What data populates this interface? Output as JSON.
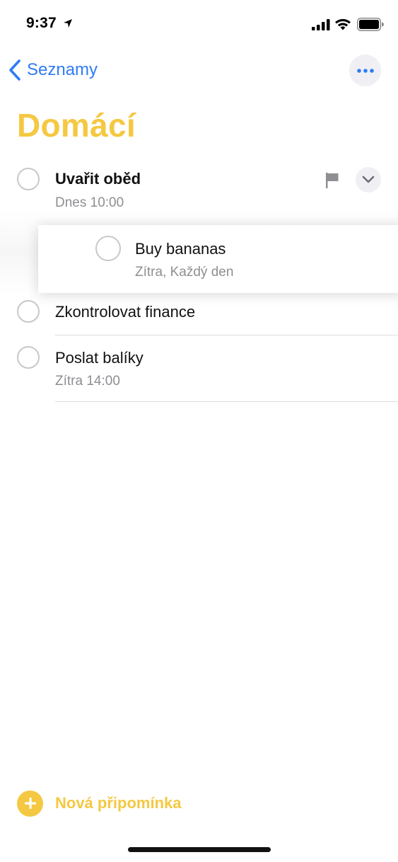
{
  "status_bar": {
    "time": "9:37"
  },
  "nav": {
    "back_label": "Seznamy"
  },
  "page": {
    "title": "Domácí"
  },
  "reminders": [
    {
      "title": "Uvařit oběd",
      "subtitle": "Dnes 10:00"
    },
    {
      "title": "Buy bananas",
      "subtitle": "Zítra, Každý den"
    },
    {
      "title": "Zkontrolovat finance",
      "subtitle": ""
    },
    {
      "title": "Poslat balíky",
      "subtitle": "Zítra 14:00"
    }
  ],
  "footer": {
    "add_label": "Nová připomínka"
  },
  "icons": {
    "back": "chevron-left-icon",
    "more": "ellipsis-icon",
    "flag": "flag-icon",
    "expand": "chevron-down-icon",
    "add": "plus-circle-icon"
  },
  "colors": {
    "accent": "#f5c842",
    "link": "#2f7cf6",
    "secondary_text": "#8e8e93"
  }
}
